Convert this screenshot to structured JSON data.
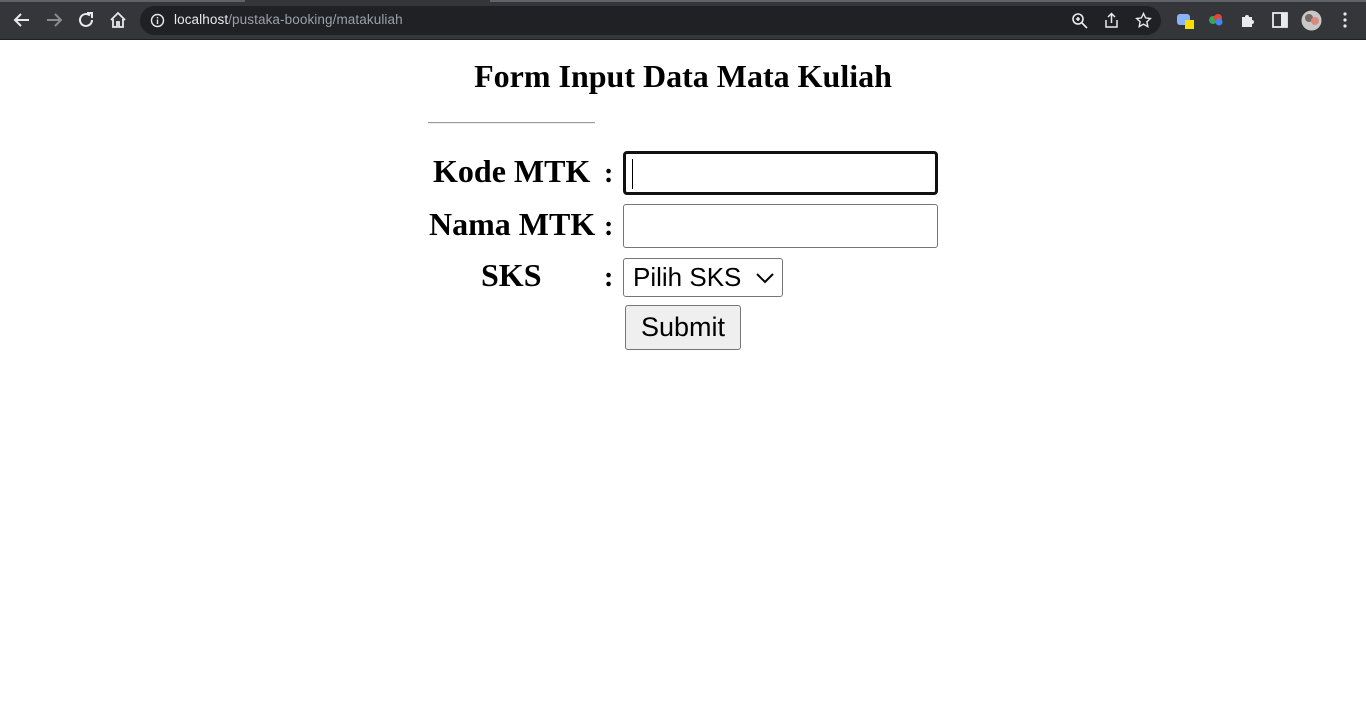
{
  "browser": {
    "url_host": "localhost",
    "url_path": "/pustaka-booking/matakuliah"
  },
  "page": {
    "title": "Form Input Data Mata Kuliah"
  },
  "form": {
    "kode_label": "Kode MTK",
    "nama_label": "Nama MTK",
    "sks_label": "SKS",
    "colon": ":",
    "kode_value": "",
    "nama_value": "",
    "sks_selected": "Pilih SKS",
    "submit_label": "Submit"
  }
}
